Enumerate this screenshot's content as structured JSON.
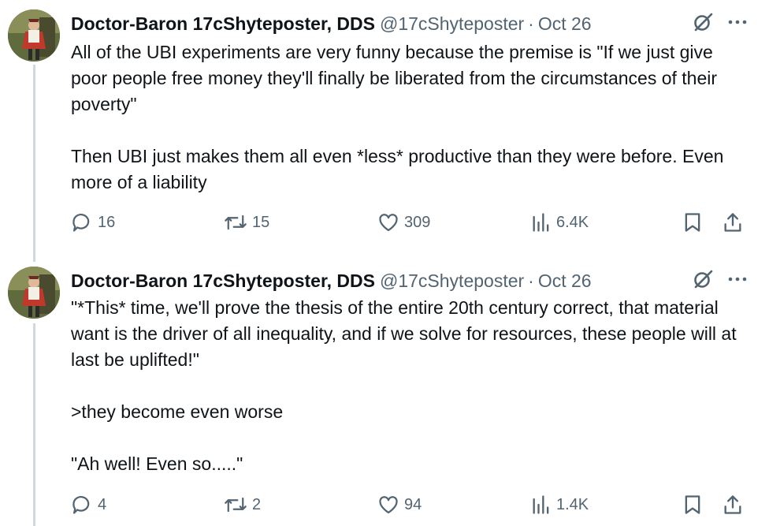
{
  "tweets": [
    {
      "display_name": "Doctor-Baron 17cShyteposter, DDS",
      "handle": "@17cShyteposter",
      "separator": "·",
      "date": "Oct 26",
      "paragraphs": [
        "All of the UBI experiments are very funny because the premise is \"If we just give poor people free money they'll finally be liberated from the circumstances of their poverty\"",
        "Then UBI just makes them all even *less* productive than they were before. Even more of a liability"
      ],
      "stats": {
        "replies": "16",
        "reposts": "15",
        "likes": "309",
        "views": "6.4K"
      }
    },
    {
      "display_name": "Doctor-Baron 17cShyteposter, DDS",
      "handle": "@17cShyteposter",
      "separator": "·",
      "date": "Oct 26",
      "paragraphs": [
        "\"*This* time, we'll prove the thesis of the entire 20th century correct, that material want is the driver of all inequality, and if we solve for resources, these people will at last be uplifted!\"",
        ">they become even worse",
        "\"Ah well! Even so.....\""
      ],
      "stats": {
        "replies": "4",
        "reposts": "2",
        "likes": "94",
        "views": "1.4K"
      }
    }
  ],
  "icons": {
    "reply": "reply-icon",
    "repost": "repost-icon",
    "like": "heart-icon",
    "views": "views-icon",
    "bookmark": "bookmark-icon",
    "share": "share-icon",
    "grok": "grok-icon",
    "more": "more-icon"
  },
  "colors": {
    "text": "#0f1419",
    "secondary": "#536471",
    "thread_line": "#cfd9de"
  }
}
